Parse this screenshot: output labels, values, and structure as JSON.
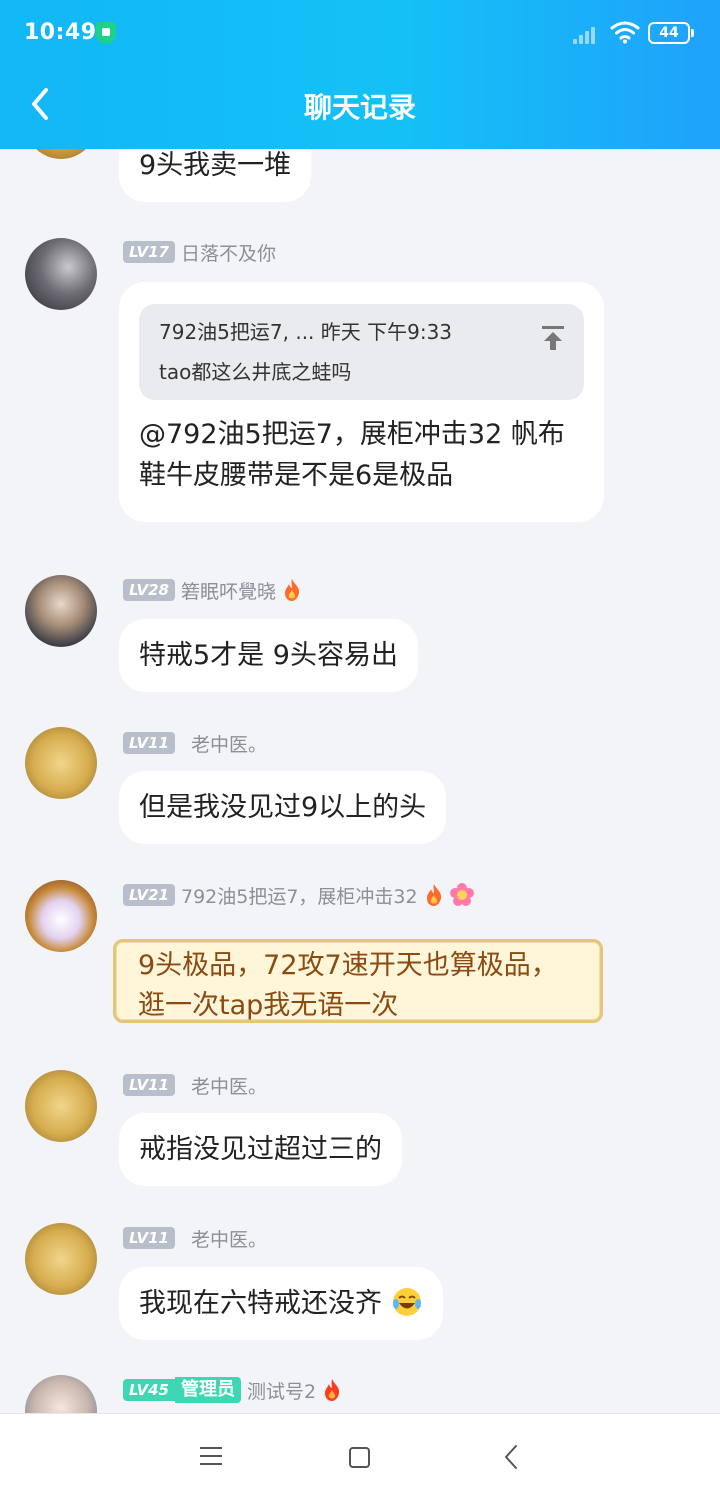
{
  "status": {
    "time": "10:49",
    "battery": "44"
  },
  "header": {
    "title": "聊天记录"
  },
  "messages": [
    {
      "text": "9头我卖一堆"
    },
    {
      "level": "LV17",
      "nick": "日落不及你",
      "quote": {
        "head": "792油5把运7, ... 昨天  下午9:33",
        "body": "tao都这么井底之蛙吗"
      },
      "text": "@792油5把运7，展柜冲击32 帆布鞋牛皮腰带是不是6是极品"
    },
    {
      "level": "LV28",
      "nick": "箬眠吥覺晓",
      "text": "特戒5才是  9头容易出"
    },
    {
      "level": "LV11",
      "nick": "老中医。",
      "text": "但是我没见过9以上的头"
    },
    {
      "level": "LV21",
      "nick": "792油5把运7，展柜冲击32",
      "text": "9头极品，72攻7速开天也算极品，逛一次tap我无语一次"
    },
    {
      "level": "LV11",
      "nick": "老中医。",
      "text": "戒指没见过超过三的"
    },
    {
      "level": "LV11",
      "nick": "老中医。",
      "text": "我现在六特戒还没齐"
    },
    {
      "level": "LV45",
      "badge": "管理员",
      "nick": "测试号2"
    }
  ]
}
